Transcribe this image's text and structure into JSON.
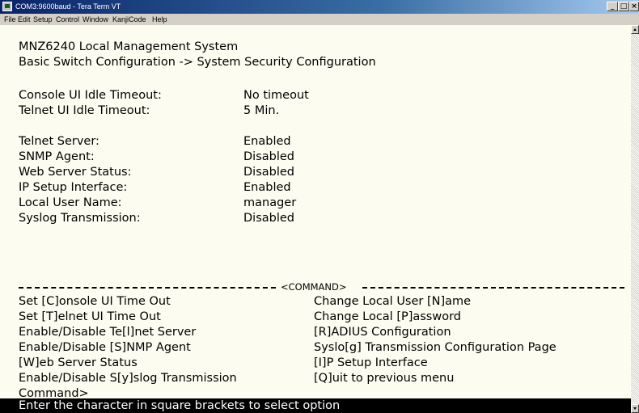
{
  "window": {
    "title": "COM3:9600baud - Tera Term VT",
    "buttons": {
      "minimize": "_",
      "maximize": "□",
      "close": "×"
    }
  },
  "menu": {
    "items": [
      "File",
      "Edit",
      "Setup",
      "Control",
      "Window",
      "KanjiCode",
      "Help"
    ]
  },
  "terminal": {
    "header": {
      "line1": "MNZ6240 Local Management System",
      "line2": "Basic Switch Configuration -> System Security Configuration"
    },
    "timeouts": [
      {
        "label": "Console UI Idle Timeout:",
        "value": "No timeout"
      },
      {
        "label": "Telnet UI Idle Timeout:",
        "value": "5 Min."
      }
    ],
    "settings": [
      {
        "label": "Telnet Server:",
        "value": "Enabled"
      },
      {
        "label": "SNMP Agent:",
        "value": "Disabled"
      },
      {
        "label": "Web Server Status:",
        "value": "Disabled"
      },
      {
        "label": "IP Setup Interface:",
        "value": "Enabled"
      },
      {
        "label": "Local User Name:",
        "value": "manager"
      },
      {
        "label": "Syslog Transmission:",
        "value": "Disabled"
      }
    ],
    "command_header": "<COMMAND>",
    "commands": [
      {
        "left": "Set [C]onsole UI Time Out",
        "right": "Change Local User [N]ame"
      },
      {
        "left": "Set [T]elnet UI Time Out",
        "right": "Change Local [P]assword"
      },
      {
        "left": "Enable/Disable Te[l]net Server",
        "right": "[R]ADIUS Configuration"
      },
      {
        "left": "Enable/Disable [S]NMP Agent",
        "right": "Syslo[g] Transmission Configuration Page"
      },
      {
        "left": "[W]eb Server Status",
        "right": "[I]P Setup Interface"
      },
      {
        "left": "Enable/Disable S[y]slog Transmission",
        "right": "[Q]uit to previous menu"
      }
    ],
    "prompt": "Command>",
    "status": "Enter the character in square brackets to select option"
  },
  "colors": {
    "terminal_bg": "#fcfcf1",
    "status_bg": "#000000",
    "status_fg": "#ffffff",
    "titlebar": "#0a246a"
  }
}
